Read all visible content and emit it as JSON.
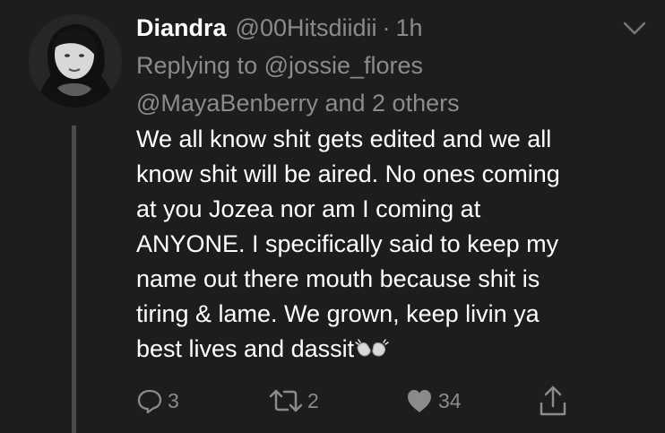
{
  "tweet": {
    "author_name": "Diandra",
    "handle": "@00Hitsdiidii",
    "separator": "·",
    "time": "1h",
    "reply_to_line_1": "Replying to @jossie_flores",
    "reply_to_line_2": "@MayaBenberry and 2 others",
    "text": "We all know shit gets edited and we all\nknow shit will be aired. No ones coming\nat you Jozea nor am I coming at\nANYONE. I specifically said to keep my\nname out there mouth because shit is\ntiring & lame. We grown, keep livin ya\nbest lives and dassit"
  },
  "actions": {
    "reply_count": "3",
    "retweet_count": "2",
    "like_count": "34"
  },
  "icons": {
    "more": "chevron-down-icon",
    "reply": "reply-icon",
    "retweet": "retweet-icon",
    "like": "heart-icon",
    "share": "share-icon",
    "emoji": "waving-hands-emoji"
  },
  "colors": {
    "background": "#1d1d1f",
    "primary_text": "#ffffff",
    "secondary_text": "#8b8b8b",
    "thread_line": "#4b4b4b"
  }
}
